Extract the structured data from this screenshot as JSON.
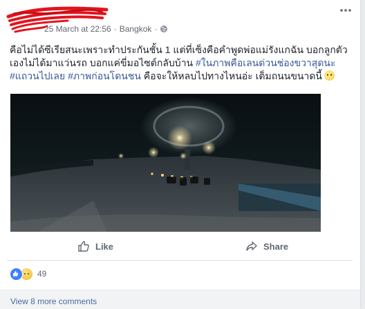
{
  "post": {
    "timestamp": "25 March at 22:56",
    "separator": "·",
    "location": "Bangkok",
    "privacy_icon": "globe-icon",
    "more_icon": "ellipsis-icon",
    "text_part1": "คือไม่ได้ซีเรียสนะเพราะทำประกันชั้น 1 แต่ที่เซ็งคือคำพูดพ่อแม่รังแกฉัน บอกลูกตัวเองไม่ได้มาแว่นรถ บอกแค่ขี่มอไซต์กลับบ้าน ",
    "tag1": "#ในภาพคือเลนด่วนช่องขวาสุดนะ",
    "tag2": "#แถวนไปเลย",
    "tag3": "#ภาพก่อนโดนชน",
    "text_part2": " คือจะให้หลบไปทางไหนอ่ะ เต็มถนนขนาดนี้",
    "emoji": "pensive-face"
  },
  "actions": {
    "like_label": "Like",
    "share_label": "Share"
  },
  "reactions": {
    "count": "49",
    "types": [
      "like",
      "sad"
    ]
  },
  "comments": {
    "view_more_label": "View 8 more comments"
  },
  "colors": {
    "link": "#365899",
    "meta": "#616770",
    "like_blue": "#4080ff"
  }
}
